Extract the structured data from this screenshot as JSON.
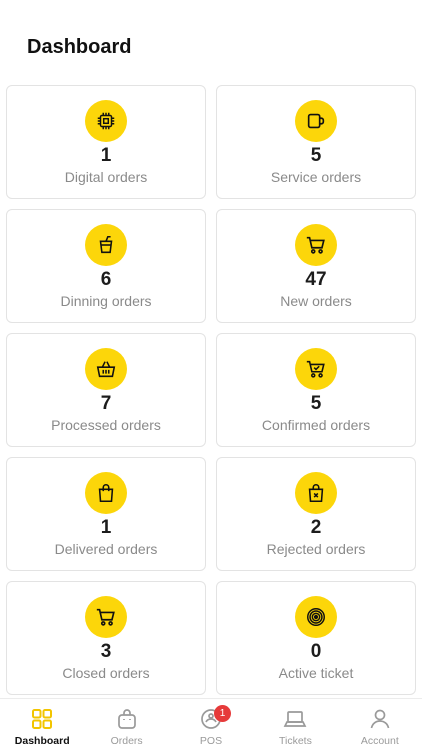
{
  "header": {
    "title": "Dashboard"
  },
  "colors": {
    "accent": "#fcd60a",
    "badge": "#e63a3a"
  },
  "cards": [
    {
      "count": "1",
      "label": "Digital orders",
      "icon": "chip-icon"
    },
    {
      "count": "5",
      "label": "Service orders",
      "icon": "mug-icon"
    },
    {
      "count": "6",
      "label": "Dinning orders",
      "icon": "drink-cup-icon"
    },
    {
      "count": "47",
      "label": "New orders",
      "icon": "cart-icon"
    },
    {
      "count": "7",
      "label": "Processed orders",
      "icon": "basket-icon"
    },
    {
      "count": "5",
      "label": "Confirmed orders",
      "icon": "cart-check-icon"
    },
    {
      "count": "1",
      "label": "Delivered orders",
      "icon": "shopping-bag-icon"
    },
    {
      "count": "2",
      "label": "Rejected orders",
      "icon": "bag-x-icon"
    },
    {
      "count": "3",
      "label": "Closed orders",
      "icon": "cart-icon"
    },
    {
      "count": "0",
      "label": "Active ticket",
      "icon": "target-icon"
    }
  ],
  "tabbar": {
    "items": [
      {
        "label": "Dashboard",
        "icon": "grid-icon"
      },
      {
        "label": "Orders",
        "icon": "bag-icon"
      },
      {
        "label": "POS",
        "icon": "pos-icon",
        "badge": "1"
      },
      {
        "label": "Tickets",
        "icon": "laptop-icon"
      },
      {
        "label": "Account",
        "icon": "user-icon"
      }
    ],
    "active": "Dashboard"
  }
}
